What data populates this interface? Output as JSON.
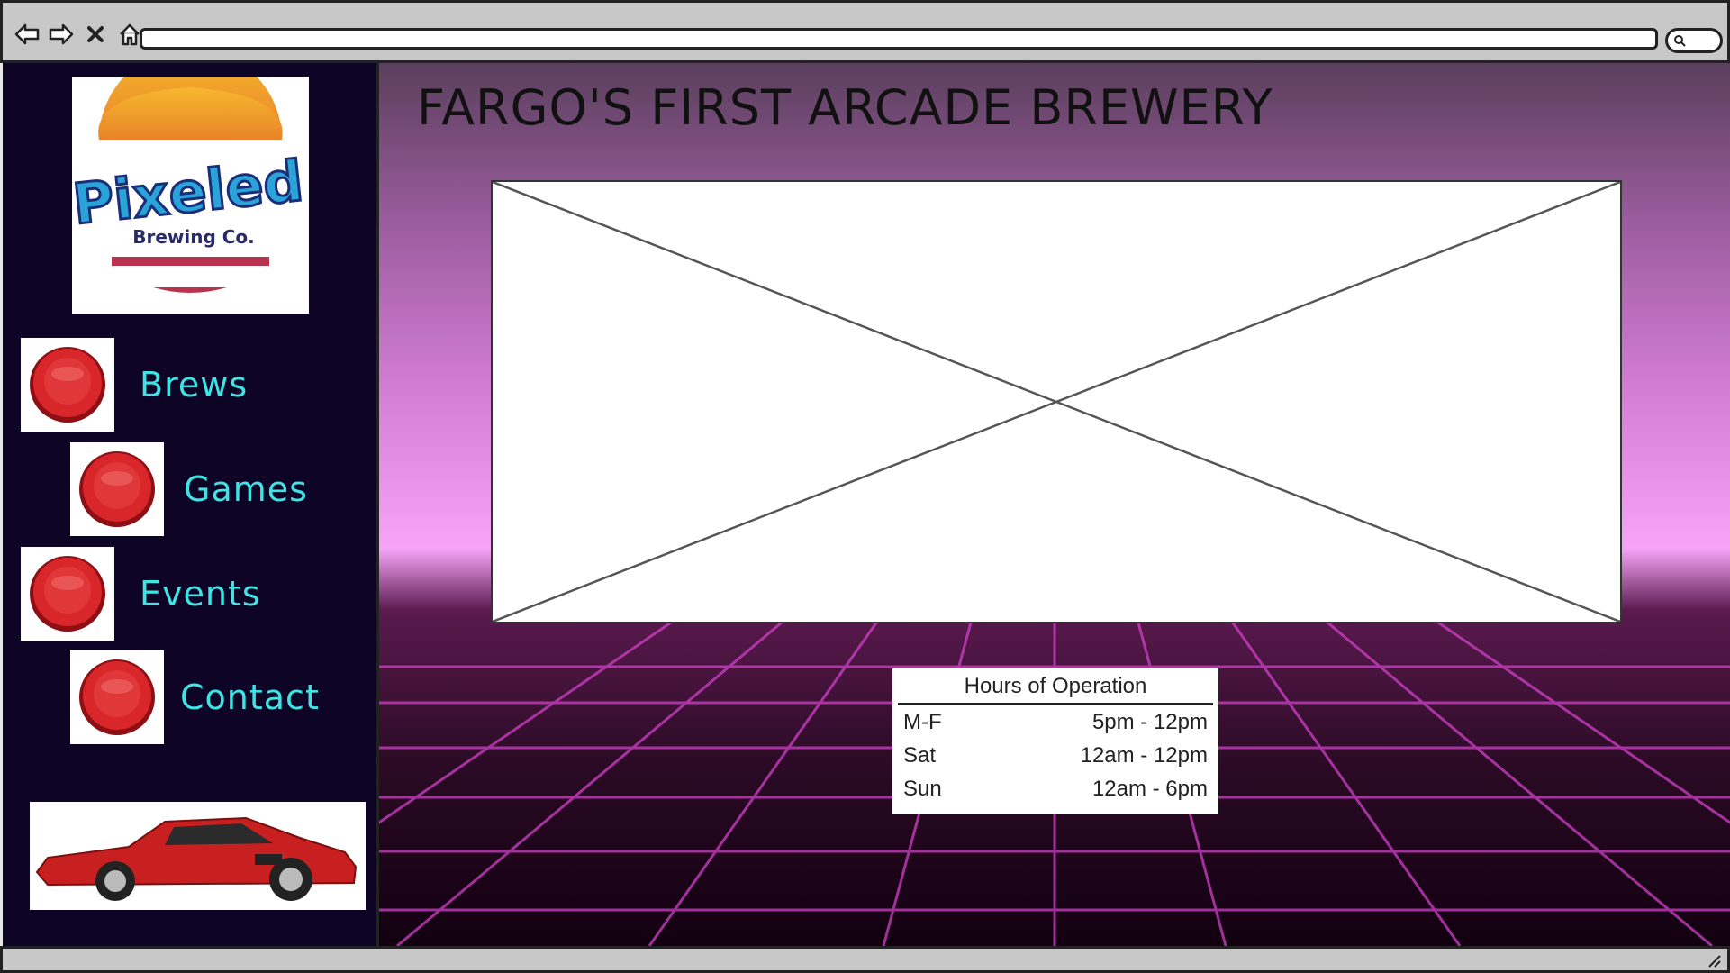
{
  "browser": {
    "icons": [
      "back-arrow-icon",
      "forward-arrow-icon",
      "close-icon",
      "home-icon"
    ],
    "url": "",
    "search_icon": "search-icon"
  },
  "sidebar": {
    "logo": {
      "icon": "pixeled-brewing-logo",
      "text_main": "Pixeled",
      "text_sub": "Brewing Co."
    },
    "nav": [
      {
        "label": "Brews",
        "icon": "arcade-button-icon"
      },
      {
        "label": "Games",
        "icon": "arcade-button-icon"
      },
      {
        "label": "Events",
        "icon": "arcade-button-icon"
      },
      {
        "label": "Contact",
        "icon": "arcade-button-icon"
      }
    ],
    "car_image": "red-sports-car-image"
  },
  "main": {
    "title": "FARGO'S FIRST ARCADE BREWERY",
    "hero_placeholder": "image-placeholder",
    "hours": {
      "title": "Hours of Operation",
      "rows": [
        {
          "day": "M-F",
          "time": "5pm - 12pm"
        },
        {
          "day": "Sat",
          "time": "12am - 12pm"
        },
        {
          "day": "Sun",
          "time": "12am - 6pm"
        }
      ]
    }
  },
  "colors": {
    "sidebar_bg": "#0d0426",
    "nav_text": "#3ee3e3",
    "button_red": "#d8262a"
  }
}
